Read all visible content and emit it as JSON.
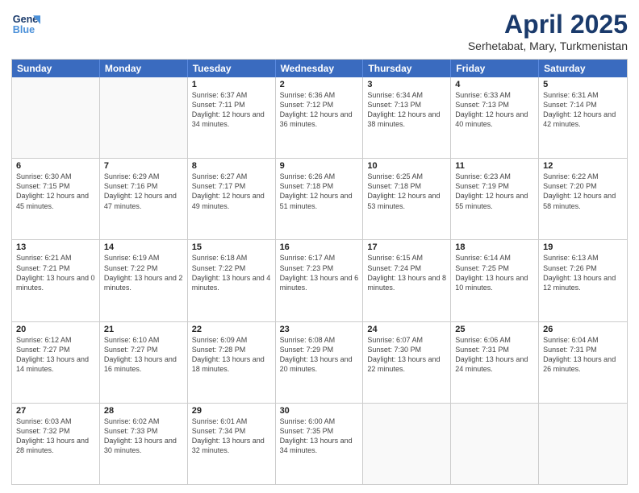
{
  "logo": {
    "line1": "General",
    "line2": "Blue"
  },
  "title": "April 2025",
  "subtitle": "Serhetabat, Mary, Turkmenistan",
  "headers": [
    "Sunday",
    "Monday",
    "Tuesday",
    "Wednesday",
    "Thursday",
    "Friday",
    "Saturday"
  ],
  "rows": [
    [
      {
        "date": "",
        "info": ""
      },
      {
        "date": "",
        "info": ""
      },
      {
        "date": "1",
        "info": "Sunrise: 6:37 AM\nSunset: 7:11 PM\nDaylight: 12 hours and 34 minutes."
      },
      {
        "date": "2",
        "info": "Sunrise: 6:36 AM\nSunset: 7:12 PM\nDaylight: 12 hours and 36 minutes."
      },
      {
        "date": "3",
        "info": "Sunrise: 6:34 AM\nSunset: 7:13 PM\nDaylight: 12 hours and 38 minutes."
      },
      {
        "date": "4",
        "info": "Sunrise: 6:33 AM\nSunset: 7:13 PM\nDaylight: 12 hours and 40 minutes."
      },
      {
        "date": "5",
        "info": "Sunrise: 6:31 AM\nSunset: 7:14 PM\nDaylight: 12 hours and 42 minutes."
      }
    ],
    [
      {
        "date": "6",
        "info": "Sunrise: 6:30 AM\nSunset: 7:15 PM\nDaylight: 12 hours and 45 minutes."
      },
      {
        "date": "7",
        "info": "Sunrise: 6:29 AM\nSunset: 7:16 PM\nDaylight: 12 hours and 47 minutes."
      },
      {
        "date": "8",
        "info": "Sunrise: 6:27 AM\nSunset: 7:17 PM\nDaylight: 12 hours and 49 minutes."
      },
      {
        "date": "9",
        "info": "Sunrise: 6:26 AM\nSunset: 7:18 PM\nDaylight: 12 hours and 51 minutes."
      },
      {
        "date": "10",
        "info": "Sunrise: 6:25 AM\nSunset: 7:18 PM\nDaylight: 12 hours and 53 minutes."
      },
      {
        "date": "11",
        "info": "Sunrise: 6:23 AM\nSunset: 7:19 PM\nDaylight: 12 hours and 55 minutes."
      },
      {
        "date": "12",
        "info": "Sunrise: 6:22 AM\nSunset: 7:20 PM\nDaylight: 12 hours and 58 minutes."
      }
    ],
    [
      {
        "date": "13",
        "info": "Sunrise: 6:21 AM\nSunset: 7:21 PM\nDaylight: 13 hours and 0 minutes."
      },
      {
        "date": "14",
        "info": "Sunrise: 6:19 AM\nSunset: 7:22 PM\nDaylight: 13 hours and 2 minutes."
      },
      {
        "date": "15",
        "info": "Sunrise: 6:18 AM\nSunset: 7:22 PM\nDaylight: 13 hours and 4 minutes."
      },
      {
        "date": "16",
        "info": "Sunrise: 6:17 AM\nSunset: 7:23 PM\nDaylight: 13 hours and 6 minutes."
      },
      {
        "date": "17",
        "info": "Sunrise: 6:15 AM\nSunset: 7:24 PM\nDaylight: 13 hours and 8 minutes."
      },
      {
        "date": "18",
        "info": "Sunrise: 6:14 AM\nSunset: 7:25 PM\nDaylight: 13 hours and 10 minutes."
      },
      {
        "date": "19",
        "info": "Sunrise: 6:13 AM\nSunset: 7:26 PM\nDaylight: 13 hours and 12 minutes."
      }
    ],
    [
      {
        "date": "20",
        "info": "Sunrise: 6:12 AM\nSunset: 7:27 PM\nDaylight: 13 hours and 14 minutes."
      },
      {
        "date": "21",
        "info": "Sunrise: 6:10 AM\nSunset: 7:27 PM\nDaylight: 13 hours and 16 minutes."
      },
      {
        "date": "22",
        "info": "Sunrise: 6:09 AM\nSunset: 7:28 PM\nDaylight: 13 hours and 18 minutes."
      },
      {
        "date": "23",
        "info": "Sunrise: 6:08 AM\nSunset: 7:29 PM\nDaylight: 13 hours and 20 minutes."
      },
      {
        "date": "24",
        "info": "Sunrise: 6:07 AM\nSunset: 7:30 PM\nDaylight: 13 hours and 22 minutes."
      },
      {
        "date": "25",
        "info": "Sunrise: 6:06 AM\nSunset: 7:31 PM\nDaylight: 13 hours and 24 minutes."
      },
      {
        "date": "26",
        "info": "Sunrise: 6:04 AM\nSunset: 7:31 PM\nDaylight: 13 hours and 26 minutes."
      }
    ],
    [
      {
        "date": "27",
        "info": "Sunrise: 6:03 AM\nSunset: 7:32 PM\nDaylight: 13 hours and 28 minutes."
      },
      {
        "date": "28",
        "info": "Sunrise: 6:02 AM\nSunset: 7:33 PM\nDaylight: 13 hours and 30 minutes."
      },
      {
        "date": "29",
        "info": "Sunrise: 6:01 AM\nSunset: 7:34 PM\nDaylight: 13 hours and 32 minutes."
      },
      {
        "date": "30",
        "info": "Sunrise: 6:00 AM\nSunset: 7:35 PM\nDaylight: 13 hours and 34 minutes."
      },
      {
        "date": "",
        "info": ""
      },
      {
        "date": "",
        "info": ""
      },
      {
        "date": "",
        "info": ""
      }
    ]
  ]
}
